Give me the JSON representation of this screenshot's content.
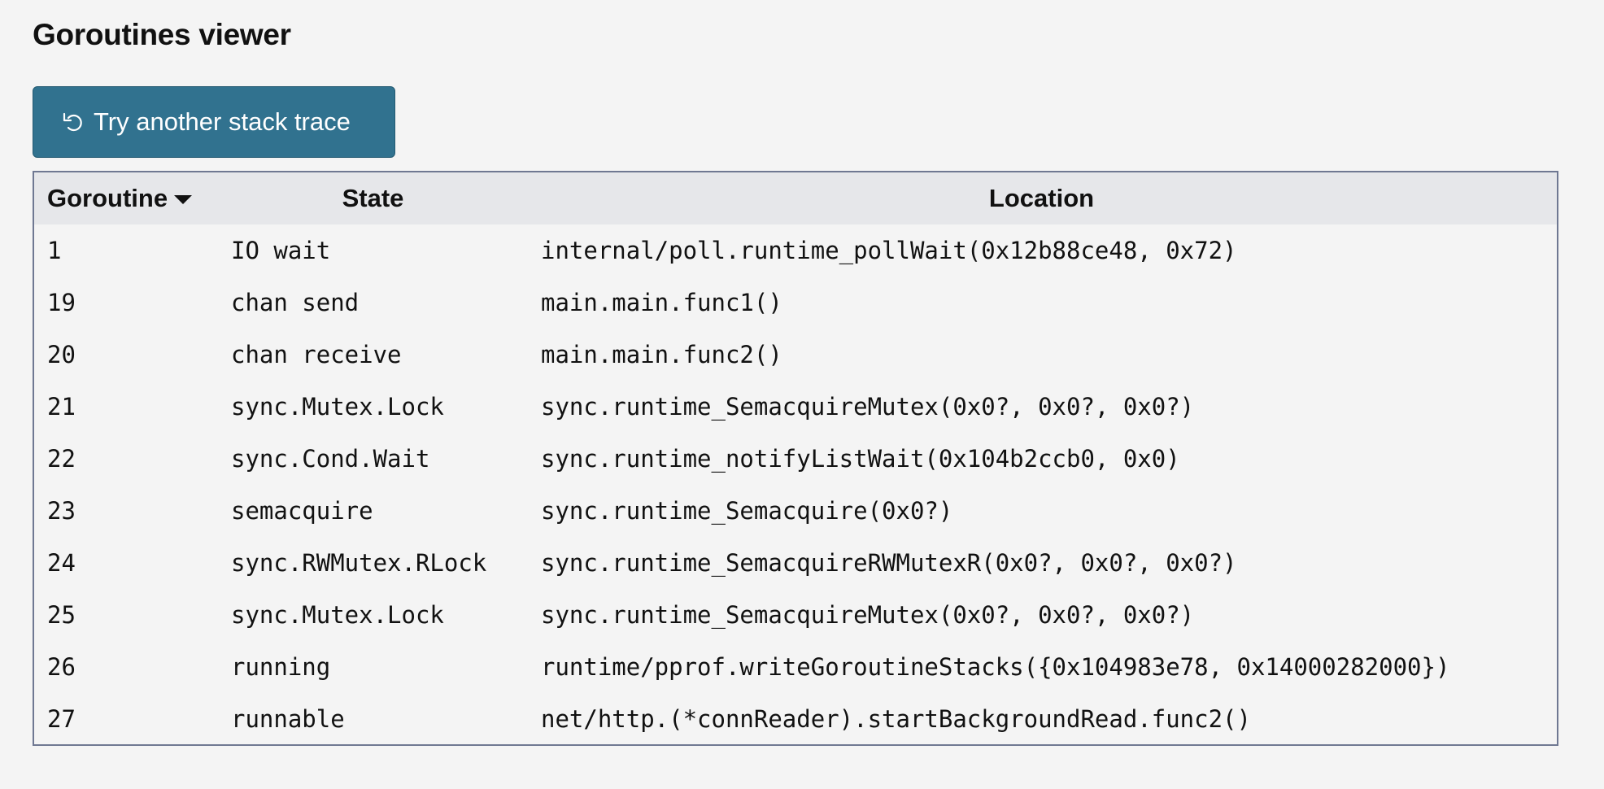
{
  "page": {
    "title": "Goroutines viewer"
  },
  "actions": {
    "retry_label": "Try another stack trace",
    "retry_icon": "undo-icon",
    "accent_color": "#31728f"
  },
  "table": {
    "sort_indicator": "sort-descending-icon",
    "columns": {
      "goroutine": "Goroutine",
      "state": "State",
      "location": "Location"
    },
    "rows": [
      {
        "goroutine": "1",
        "state": "IO wait",
        "location": "internal/poll.runtime_pollWait(0x12b88ce48, 0x72)"
      },
      {
        "goroutine": "19",
        "state": "chan send",
        "location": "main.main.func1()"
      },
      {
        "goroutine": "20",
        "state": "chan receive",
        "location": "main.main.func2()"
      },
      {
        "goroutine": "21",
        "state": "sync.Mutex.Lock",
        "location": "sync.runtime_SemacquireMutex(0x0?, 0x0?, 0x0?)"
      },
      {
        "goroutine": "22",
        "state": "sync.Cond.Wait",
        "location": "sync.runtime_notifyListWait(0x104b2ccb0, 0x0)"
      },
      {
        "goroutine": "23",
        "state": "semacquire",
        "location": "sync.runtime_Semacquire(0x0?)"
      },
      {
        "goroutine": "24",
        "state": "sync.RWMutex.RLock",
        "location": "sync.runtime_SemacquireRWMutexR(0x0?, 0x0?, 0x0?)"
      },
      {
        "goroutine": "25",
        "state": "sync.Mutex.Lock",
        "location": "sync.runtime_SemacquireMutex(0x0?, 0x0?, 0x0?)"
      },
      {
        "goroutine": "26",
        "state": "running",
        "location": "runtime/pprof.writeGoroutineStacks({0x104983e78, 0x14000282000})"
      },
      {
        "goroutine": "27",
        "state": "runnable",
        "location": "net/http.(*connReader).startBackgroundRead.func2()"
      }
    ]
  }
}
